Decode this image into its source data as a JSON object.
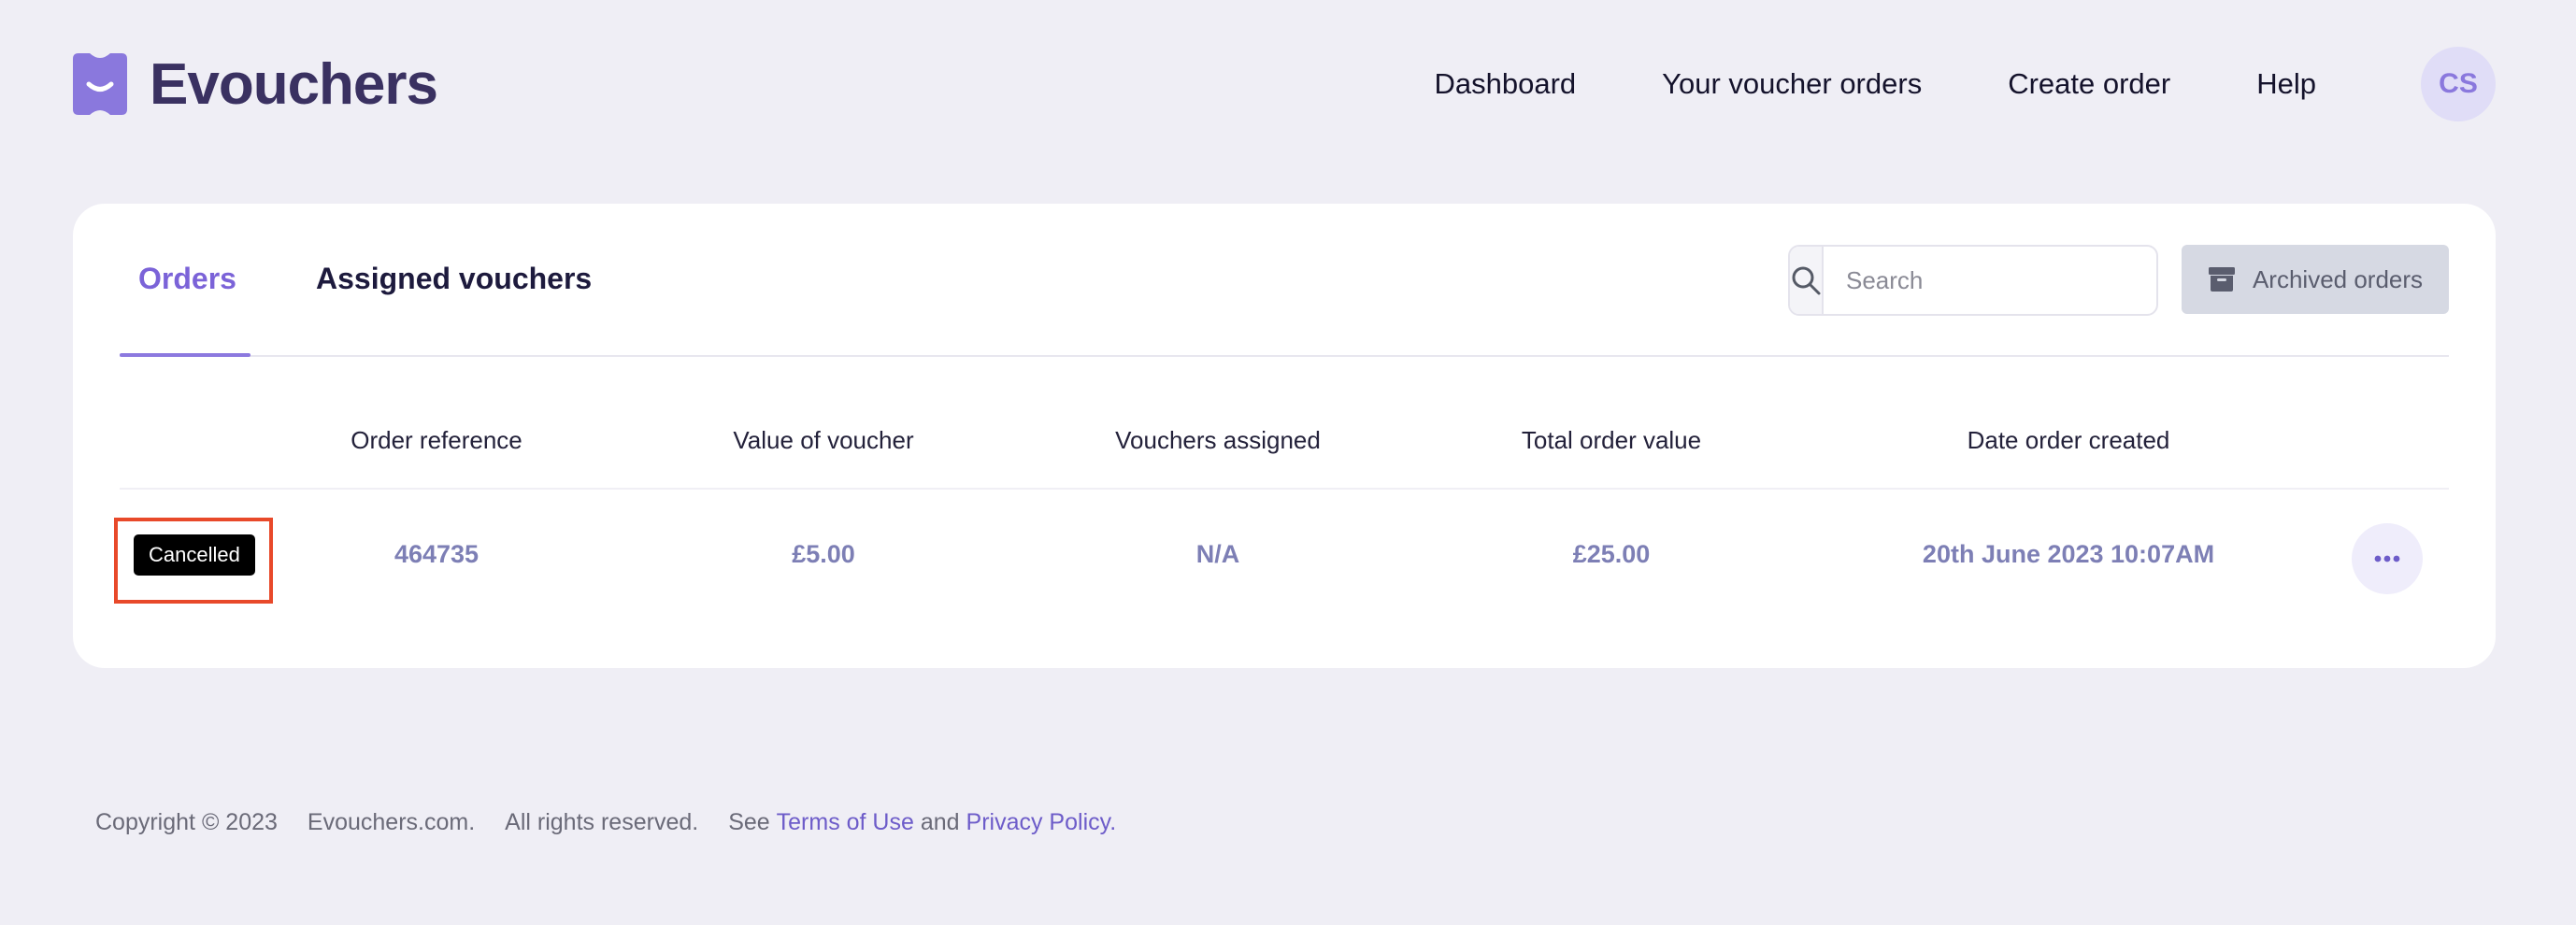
{
  "brand": {
    "name": "Evouchers",
    "logo_icon": "voucher-smile-icon",
    "color": "#8a78dd"
  },
  "nav": {
    "items": [
      "Dashboard",
      "Your voucher orders",
      "Create order",
      "Help"
    ],
    "avatar_initials": "CS"
  },
  "tabs": [
    {
      "label": "Orders",
      "active": true
    },
    {
      "label": "Assigned vouchers",
      "active": false
    }
  ],
  "search": {
    "placeholder": "Search",
    "value": "",
    "icon": "search-icon"
  },
  "archived": {
    "label": "Archived orders",
    "icon": "archive-box-icon"
  },
  "table": {
    "columns": [
      "Order reference",
      "Value of voucher",
      "Vouchers assigned",
      "Total order value",
      "Date order created"
    ],
    "rows": [
      {
        "status": "Cancelled",
        "order_reference": "464735",
        "value_of_voucher": "£5.00",
        "vouchers_assigned": "N/A",
        "total_order_value": "£25.00",
        "date_created": "20th June 2023 10:07AM",
        "actions_icon": "more-dots-icon"
      }
    ]
  },
  "footer": {
    "copyright": "Copyright © 2023",
    "site": "Evouchers.com.",
    "rights": "All rights reserved.",
    "see": "See",
    "terms": "Terms of Use",
    "and": "and",
    "privacy": "Privacy Policy."
  },
  "colors": {
    "accent": "#7b63d8",
    "background": "#efeef5",
    "badge_bg": "#000000",
    "highlight": "#e8492a",
    "value_text": "#7d7fb5"
  }
}
